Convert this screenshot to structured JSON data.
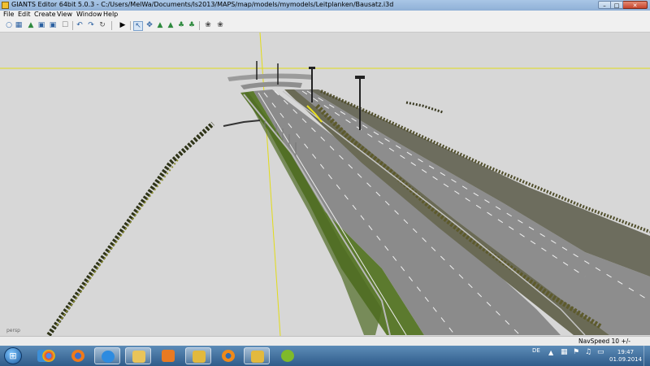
{
  "window": {
    "title": "GIANTS Editor 64bit 5.0.3 - C:/Users/MelWa/Documents/ls2013/MAPS/map/models/mymodels/Leitplanken/Bausatz.i3d",
    "minimize_label": "–",
    "maximize_label": "□",
    "close_label": "✕"
  },
  "menu": [
    "File",
    "Edit",
    "Create",
    "View",
    "Window",
    "Help"
  ],
  "toolbar": {
    "icons": [
      "new-file-icon",
      "open-folder-icon",
      "import-icon",
      "save-icon",
      "save-as-icon",
      "cut-icon",
      "undo-icon",
      "redo-icon",
      "play-icon",
      "select-icon",
      "move-icon",
      "rotate-icon",
      "scale-icon",
      "terrain-sculpt-icon",
      "terrain-paint-icon",
      "foliage-icon",
      "snap-icon",
      "grid-icon"
    ]
  },
  "viewport": {
    "camera_label": "persp"
  },
  "status": {
    "navspeed": "NavSpeed 10 +/-"
  },
  "taskbar": {
    "apps": [
      "internet-explorer",
      "chrome",
      "firefox",
      "ie-edge",
      "file-explorer",
      "media-player",
      "giants-editor",
      "blender",
      "giants-editor-2",
      "spotify"
    ],
    "language": "DE",
    "time": "19:47",
    "date": "01.09.2014"
  },
  "colors": {
    "title_gradient_top": "#a9c6e6",
    "viewport_bg": "#d7d7d7",
    "axis_yellow": "#e8e020",
    "grass": "#5a7a2a",
    "asphalt": "#8a8a8a",
    "taskbar": "#3d6b98"
  }
}
